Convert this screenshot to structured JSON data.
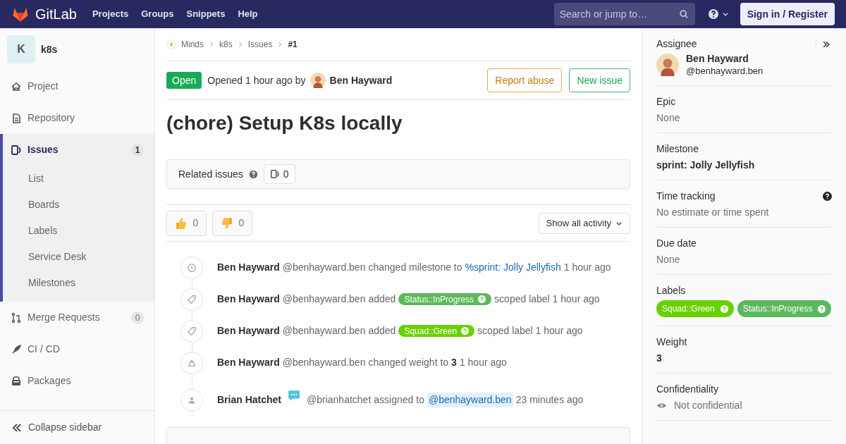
{
  "header": {
    "brand": "GitLab",
    "nav": [
      "Projects",
      "Groups",
      "Snippets",
      "Help"
    ],
    "search": {
      "placeholder": "Search or jump to…"
    },
    "sign_in": "Sign in / Register"
  },
  "sidebar": {
    "project_initial": "K",
    "project_name": "k8s",
    "items": [
      {
        "label": "Project",
        "selected": false
      },
      {
        "label": "Repository",
        "selected": false
      },
      {
        "label": "Issues",
        "selected": true,
        "count": "1",
        "children": [
          {
            "label": "List"
          },
          {
            "label": "Boards"
          },
          {
            "label": "Labels"
          },
          {
            "label": "Service Desk"
          },
          {
            "label": "Milestones"
          }
        ]
      },
      {
        "label": "Merge Requests",
        "selected": false,
        "count": "0"
      },
      {
        "label": "CI / CD",
        "selected": false
      },
      {
        "label": "Packages",
        "selected": false
      }
    ],
    "collapse": "Collapse sidebar"
  },
  "breadcrumbs": [
    "Minds",
    "k8s",
    "Issues",
    "#1"
  ],
  "issue": {
    "status": "Open",
    "opened": "Opened 1 hour ago by",
    "author": "Ben Hayward",
    "buttons": [
      "Report abuse",
      "New issue"
    ],
    "title": "(chore) Setup K8s locally",
    "related": {
      "label": "Related issues",
      "count": "0"
    },
    "reactions": [
      {
        "kind": "up",
        "count": "0"
      },
      {
        "kind": "down",
        "count": "0"
      }
    ],
    "activity_filter": "Show all activity"
  },
  "events": [
    {
      "kind": "milestone",
      "author": "Ben Hayward",
      "badge": false,
      "handle": "@benhayward.ben",
      "parts": [
        {
          "kind": "text",
          "text": "changed milestone to"
        },
        {
          "kind": "link",
          "text": "%sprint: Jolly Jellyfish"
        },
        {
          "kind": "text",
          "text": "1 hour ago"
        }
      ]
    },
    {
      "kind": "label",
      "author": "Ben Hayward",
      "badge": false,
      "handle": "@benhayward.ben",
      "parts": [
        {
          "kind": "text",
          "text": "added"
        },
        {
          "kind": "label",
          "text": "Status::InProgress",
          "color": "#5cb85c"
        },
        {
          "kind": "text",
          "text": "scoped label 1 hour ago"
        }
      ]
    },
    {
      "kind": "label",
      "author": "Ben Hayward",
      "badge": false,
      "handle": "@benhayward.ben",
      "parts": [
        {
          "kind": "text",
          "text": "added"
        },
        {
          "kind": "label",
          "text": "Squad::Green",
          "color": "#69d100"
        },
        {
          "kind": "text",
          "text": "scoped label 1 hour ago"
        }
      ]
    },
    {
      "kind": "weight",
      "author": "Ben Hayward",
      "badge": false,
      "handle": "@benhayward.ben",
      "parts": [
        {
          "kind": "text",
          "text": "changed weight to"
        },
        {
          "kind": "bold",
          "text": "3"
        },
        {
          "kind": "text",
          "text": "1 hour ago"
        }
      ]
    },
    {
      "kind": "assignee",
      "author": "Brian Hatchet",
      "badge": true,
      "handle": "@brianhatchet",
      "parts": [
        {
          "kind": "text",
          "text": "assigned to"
        },
        {
          "kind": "mention",
          "text": "@benhayward.ben"
        },
        {
          "kind": "text",
          "text": "23 minutes ago"
        }
      ]
    }
  ],
  "right_sidebar": {
    "assignee": {
      "title": "Assignee",
      "name": "Ben Hayward",
      "handle": "@benhayward.ben"
    },
    "blocks": [
      {
        "kind": "plain",
        "title": "Epic",
        "value": "None"
      },
      {
        "kind": "bold",
        "title": "Milestone",
        "value": "sprint: Jolly Jellyfish"
      },
      {
        "kind": "help",
        "title": "Time tracking",
        "value": "No estimate or time spent"
      },
      {
        "kind": "plain",
        "title": "Due date",
        "value": "None"
      },
      {
        "kind": "labels",
        "title": "Labels",
        "labels": [
          {
            "text": "Squad::Green",
            "color": "#69d100"
          },
          {
            "text": "Status::InProgress",
            "color": "#5cb85c"
          }
        ]
      },
      {
        "kind": "bold",
        "title": "Weight",
        "value": "3"
      },
      {
        "kind": "eye",
        "title": "Confidentiality",
        "value": "Not confidential"
      }
    ]
  }
}
